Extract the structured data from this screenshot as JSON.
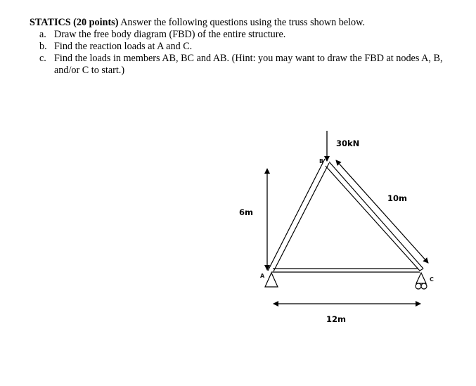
{
  "question": {
    "title": "STATICS",
    "points": "(20 points)",
    "prompt": "Answer the following questions using the truss shown below.",
    "items": [
      {
        "letter": "a.",
        "text": "Draw the free body diagram (FBD) of the entire structure."
      },
      {
        "letter": "b.",
        "text": "Find the reaction loads at A and C."
      },
      {
        "letter": "c.",
        "text": "Find the loads in members AB, BC and AB. (Hint: you may want to draw the FBD at nodes A, B, and/or C to start.)"
      }
    ]
  },
  "diagram": {
    "load_label": "30kN",
    "height_label": "6m",
    "span_label": "12m",
    "diagonal_label": "10m",
    "nodes": {
      "a": "A",
      "b": "B",
      "c": "C"
    },
    "supports": {
      "a": "pin",
      "c": "roller"
    }
  }
}
